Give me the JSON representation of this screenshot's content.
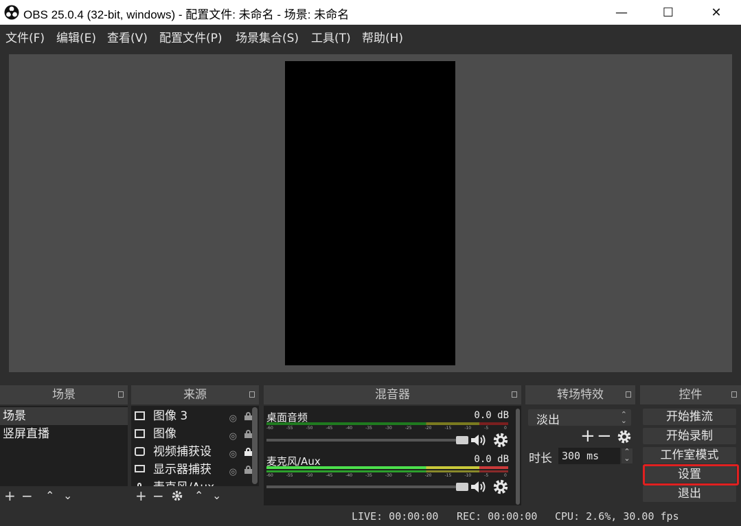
{
  "window": {
    "title": "OBS 25.0.4 (32-bit, windows) - 配置文件: 未命名 - 场景: 未命名",
    "minimize": "—",
    "maximize": "☐",
    "close": "✕"
  },
  "menu": [
    "文件(F)",
    "编辑(E)",
    "查看(V)",
    "配置文件(P)",
    "场景集合(S)",
    "工具(T)",
    "帮助(H)"
  ],
  "scenes": {
    "title": "场景",
    "items": [
      "场景",
      "竖屏直播"
    ],
    "selected_index": 0
  },
  "sources": {
    "title": "来源",
    "items": [
      {
        "name": "图像 3",
        "icon": "image-icon",
        "locked": false
      },
      {
        "name": "图像",
        "icon": "image-icon",
        "locked": false
      },
      {
        "name": "视频捕获设",
        "icon": "camera-icon",
        "locked": true
      },
      {
        "name": "显示器捕获",
        "icon": "monitor-icon",
        "locked": false
      },
      {
        "name": "麦克风/Aux",
        "icon": "microphone-icon",
        "locked": false
      }
    ]
  },
  "mixer": {
    "title": "混音器",
    "ticks": [
      "-60",
      "-55",
      "-50",
      "-45",
      "-40",
      "-35",
      "-30",
      "-25",
      "-20",
      "-15",
      "-10",
      "-5",
      "0"
    ],
    "channels": [
      {
        "name": "桌面音频",
        "db": "0.0 dB",
        "level": 0.0
      },
      {
        "name": "麦克风/Aux",
        "db": "0.0 dB",
        "level": 1.0
      }
    ]
  },
  "transitions": {
    "title": "转场特效",
    "selected": "淡出",
    "duration_label": "时长",
    "duration_value": "300 ms"
  },
  "controls": {
    "title": "控件",
    "buttons": [
      "开始推流",
      "开始录制",
      "工作室模式",
      "设置",
      "退出"
    ],
    "highlighted": "设置",
    "highlight_color": "#e02020"
  },
  "status": {
    "live": "LIVE: 00:00:00",
    "rec": "REC: 00:00:00",
    "cpu": "CPU: 2.6%, 30.00 fps"
  }
}
